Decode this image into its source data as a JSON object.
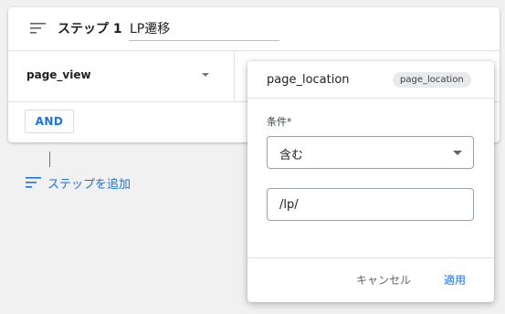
{
  "step": {
    "title": "ステップ 1",
    "name_value": "LP遷移",
    "event_name": "page_view",
    "and_label": "AND"
  },
  "add_step": {
    "label": "ステップを追加",
    "icon": "filter-list-add-icon"
  },
  "popover": {
    "title": "page_location",
    "chip": "page_location",
    "condition_label": "条件*",
    "condition_value": "含む",
    "input_value": "/lp/",
    "cancel_label": "キャンセル",
    "apply_label": "適用"
  },
  "colors": {
    "accent": "#1a73e8",
    "background": "#f1f1f1",
    "chip_bg": "#e8eaed"
  }
}
